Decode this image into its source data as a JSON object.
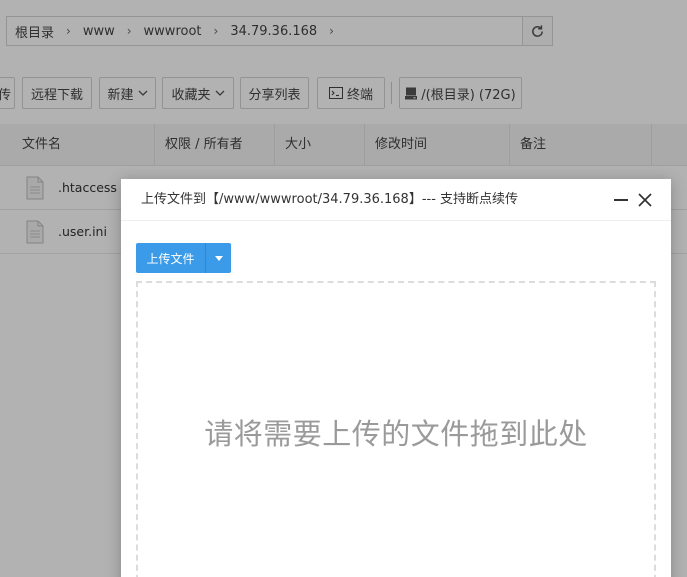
{
  "breadcrumb": {
    "items": [
      "根目录",
      "www",
      "wwwroot",
      "34.79.36.168"
    ],
    "separator": "›"
  },
  "toolbar": {
    "upload_partial": "传",
    "remote_download": "远程下载",
    "new": "新建",
    "favorites": "收藏夹",
    "share_list": "分享列表",
    "terminal": "终端",
    "disk": "/(根目录) (72G)"
  },
  "table": {
    "headers": [
      "文件名",
      "权限 / 所有者",
      "大小",
      "修改时间",
      "备注"
    ],
    "rows": [
      {
        "name": ".htaccess"
      },
      {
        "name": ".user.ini"
      }
    ]
  },
  "dialog": {
    "title": "上传文件到【/www/wwwroot/34.79.36.168】--- 支持断点续传",
    "upload_button": "上传文件",
    "drop_hint": "请将需要上传的文件拖到此处"
  },
  "icons": {
    "refresh": "refresh-icon",
    "terminal": "terminal-icon",
    "disk": "disk-icon",
    "file": "file-icon",
    "minimize": "minimize-icon",
    "close": "close-icon",
    "dropdown": "caret-down-icon"
  },
  "colors": {
    "primary": "#3c9be8",
    "overlay": "rgba(0,0,0,0.30)",
    "drop_text": "#9a9a9a"
  }
}
